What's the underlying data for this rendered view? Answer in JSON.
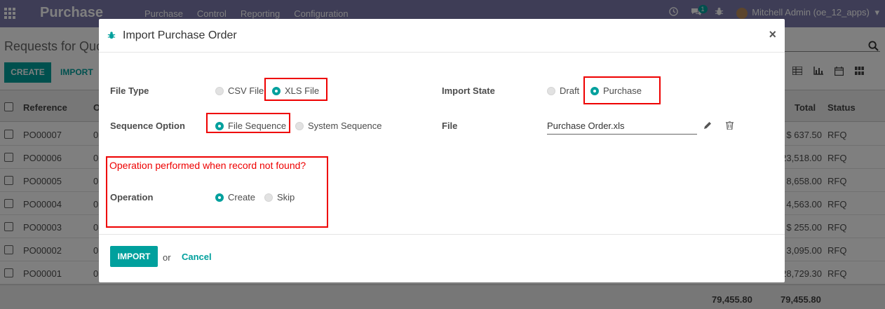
{
  "navbar": {
    "brand": "Purchase",
    "menu": [
      "Purchase",
      "Control",
      "Reporting",
      "Configuration"
    ],
    "chat_count": "1",
    "user": "Mitchell Admin (oe_12_apps)"
  },
  "control_panel": {
    "title": "Requests for Quo",
    "create_label": "CREATE",
    "import_label": "IMPORT"
  },
  "list": {
    "headers": {
      "reference": "Reference",
      "o": "O",
      "total": "Total",
      "status": "Status"
    },
    "rows": [
      {
        "ref": "PO00007",
        "o": "0",
        "total": "$ 637.50",
        "status": "RFQ"
      },
      {
        "ref": "PO00006",
        "o": "0",
        "total": "23,518.00",
        "status": "RFQ"
      },
      {
        "ref": "PO00005",
        "o": "0",
        "total": "8,658.00",
        "status": "RFQ"
      },
      {
        "ref": "PO00004",
        "o": "0",
        "total": "4,563.00",
        "status": "RFQ"
      },
      {
        "ref": "PO00003",
        "o": "0",
        "total": "$ 255.00",
        "status": "RFQ"
      },
      {
        "ref": "PO00002",
        "o": "0",
        "total": "3,095.00",
        "status": "RFQ"
      },
      {
        "ref": "PO00001",
        "o": "0",
        "total": "28,729.30",
        "status": "RFQ"
      }
    ],
    "footer_sum_1": "79,455.80",
    "footer_sum_2": "79,455.80"
  },
  "modal": {
    "title": "Import Purchase Order",
    "close": "×",
    "file_type": {
      "label": "File Type",
      "options": [
        "CSV File",
        "XLS File"
      ],
      "selected": "XLS File"
    },
    "import_state": {
      "label": "Import State",
      "options": [
        "Draft",
        "Purchase"
      ],
      "selected": "Purchase"
    },
    "sequence_option": {
      "label": "Sequence Option",
      "options": [
        "File Sequence",
        "System Sequence"
      ],
      "selected": "File Sequence"
    },
    "file": {
      "label": "File",
      "value": "Purchase Order.xls"
    },
    "operation_caption": "Operation performed when record not found?",
    "operation": {
      "label": "Operation",
      "options": [
        "Create",
        "Skip"
      ],
      "selected": "Create"
    },
    "import_button": "IMPORT",
    "or_text": "or",
    "cancel_button": "Cancel"
  },
  "colors": {
    "accent": "#00a09d",
    "navbar": "#7c7bad",
    "highlight": "#e00000"
  }
}
